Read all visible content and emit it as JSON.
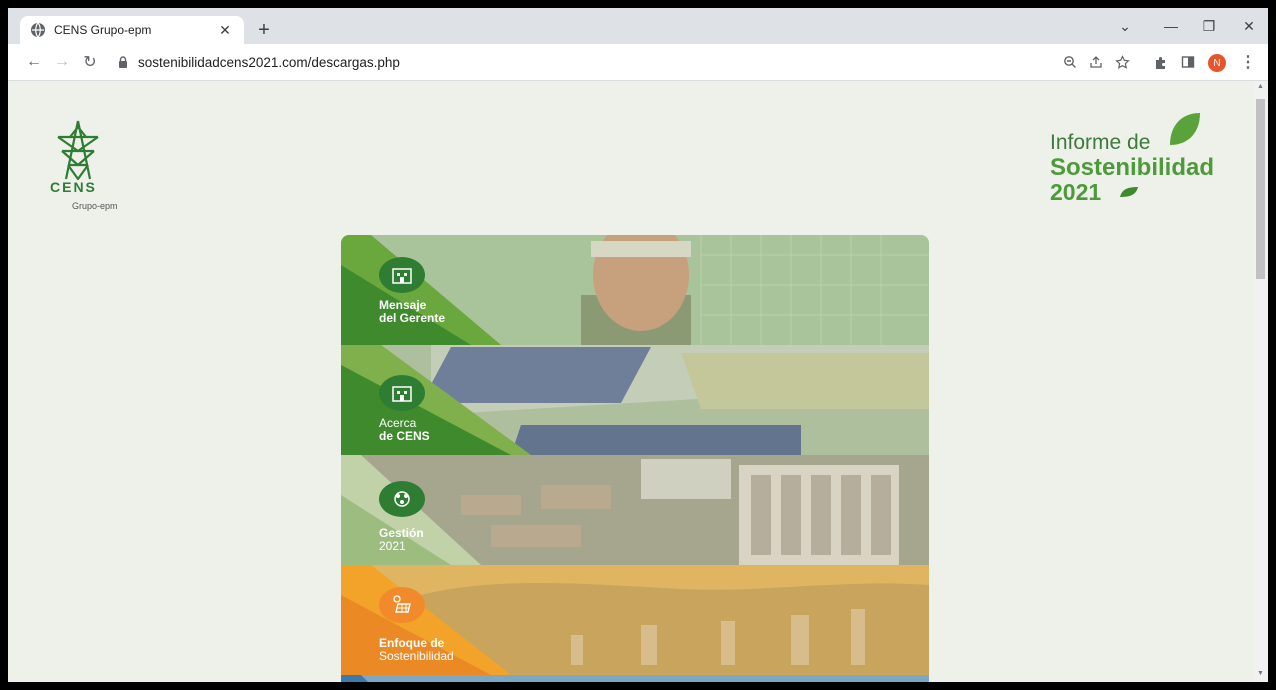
{
  "browser": {
    "tab_title": "CENS Grupo-epm",
    "url": "sostenibilidadcens2021.com/descargas.php",
    "profile_initial": "N"
  },
  "page": {
    "logo_left_text": "CENS",
    "logo_left_sub": "Grupo-epm",
    "report_title_line1": "Informe de",
    "report_title_line2": "Sostenibilidad",
    "report_title_line3": "2021"
  },
  "cards": [
    {
      "line1": "Mensaje",
      "line2": "del Gerente"
    },
    {
      "line1": "Acerca",
      "line2": "de CENS"
    },
    {
      "line1": "Gestión",
      "line2": "2021"
    },
    {
      "line1": "Enfoque de",
      "line2": "Sostenibilidad"
    }
  ],
  "colors": {
    "green_dark": "#2f7d32",
    "green_light": "#7cb342",
    "orange": "#f5a623",
    "accent_profile": "#e8552c"
  }
}
